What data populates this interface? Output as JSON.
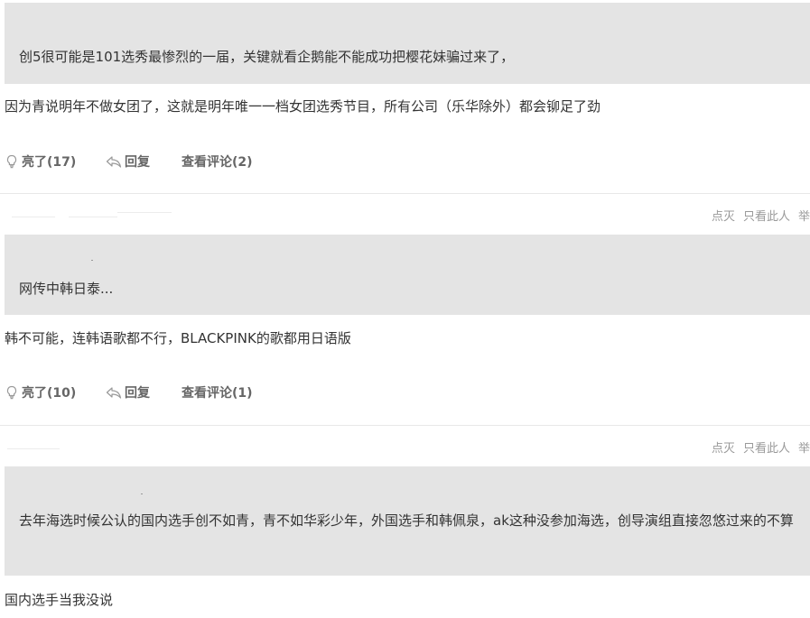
{
  "posts": [
    {
      "quote": "创5很可能是101选秀最惨烈的一届，关键就看企鹅能不能成功把樱花妹骗过来了，",
      "body": "因为青说明年不做女团了，这就是明年唯一一档女团选秀节目，所有公司（乐华除外）都会铆足了劲",
      "light_label": "亮了(17)",
      "reply_label": "回复",
      "view_label": "查看评论(2)"
    },
    {
      "quote": "网传中韩日泰...",
      "body": "韩不可能，连韩语歌都不行，BLACKPINK的歌都用日语版",
      "light_label": "亮了(10)",
      "reply_label": "回复",
      "view_label": "查看评论(1)"
    },
    {
      "quote": "去年海选时候公认的国内选手创不如青，青不如华彩少年，外国选手和韩佩泉，ak这种没参加海选，创导演组直接忽悠过来的不算",
      "body": "国内选手当我没说"
    }
  ],
  "meta": {
    "dislike_label": "点灭",
    "only_label": "只看此人",
    "cut_label": "举"
  }
}
